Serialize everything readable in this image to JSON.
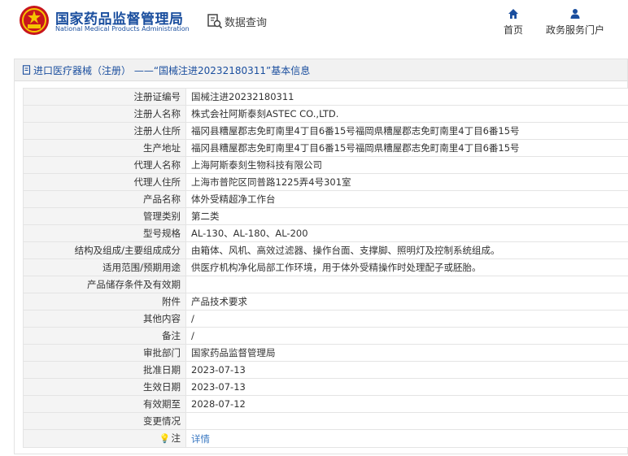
{
  "header": {
    "brand_cn": "国家药品监督管理局",
    "brand_en": "National Medical Products Administration",
    "query_label": "数据查询",
    "nav": [
      {
        "label": "首页",
        "icon": "home-icon"
      },
      {
        "label": "政务服务门户",
        "icon": "user-icon"
      }
    ],
    "brand_color": "#1a4e9e"
  },
  "panel": {
    "title": "进口医疗器械（注册） ——“国械注进20232180311”基本信息",
    "rows": [
      {
        "label": "注册证编号",
        "value": "国械注进20232180311"
      },
      {
        "label": "注册人名称",
        "value": "株式会社阿斯泰刻ASTEC CO.,LTD."
      },
      {
        "label": "注册人住所",
        "value": "福冈县糟屋郡志免町南里4丁目6番15号福岡県糟屋郡志免町南里4丁目6番15号"
      },
      {
        "label": "生产地址",
        "value": "福冈县糟屋郡志免町南里4丁目6番15号福岡県糟屋郡志免町南里4丁目6番15号"
      },
      {
        "label": "代理人名称",
        "value": "上海阿斯泰刻生物科技有限公司"
      },
      {
        "label": "代理人住所",
        "value": "上海市普陀区同普路1225弄4号301室"
      },
      {
        "label": "产品名称",
        "value": "体外受精超净工作台"
      },
      {
        "label": "管理类别",
        "value": "第二类"
      },
      {
        "label": "型号规格",
        "value": "AL-130、AL-180、AL-200"
      },
      {
        "label": "结构及组成/主要组成成分",
        "value": "由箱体、风机、高效过滤器、操作台面、支撑脚、照明灯及控制系统组成。"
      },
      {
        "label": "适用范围/预期用途",
        "value": "供医疗机构净化局部工作环境，用于体外受精操作时处理配子或胚胎。"
      },
      {
        "label": "产品储存条件及有效期",
        "value": ""
      },
      {
        "label": "附件",
        "value": "产品技术要求"
      },
      {
        "label": "其他内容",
        "value": "/"
      },
      {
        "label": "备注",
        "value": "/"
      },
      {
        "label": "审批部门",
        "value": "国家药品监督管理局"
      },
      {
        "label": "批准日期",
        "value": "2023-07-13"
      },
      {
        "label": "生效日期",
        "value": "2023-07-13"
      },
      {
        "label": "有效期至",
        "value": "2028-07-12"
      },
      {
        "label": "变更情况",
        "value": ""
      }
    ],
    "note": {
      "label": "注",
      "link": "详情"
    }
  }
}
